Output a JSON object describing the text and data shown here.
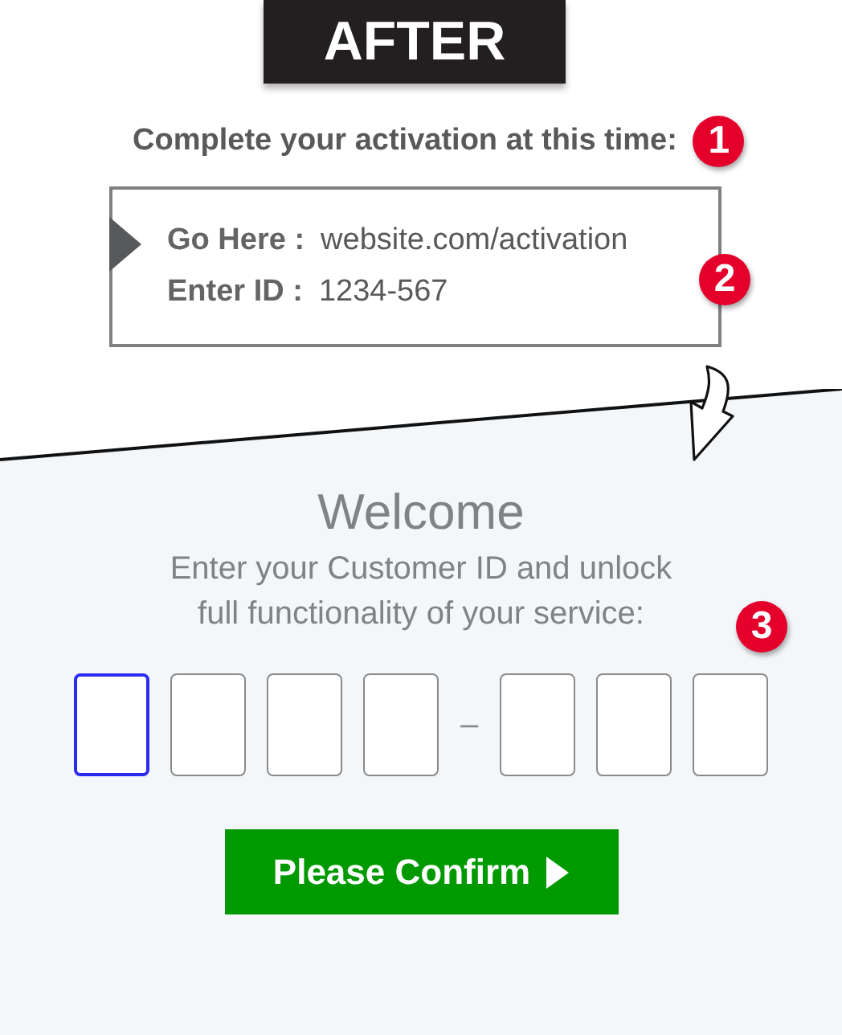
{
  "header": {
    "title": "AFTER"
  },
  "instruction": {
    "text": "Complete your activation at this time:",
    "badge": "1"
  },
  "info_box": {
    "badge": "2",
    "rows": [
      {
        "label": "Go Here :",
        "value": "website.com/activation"
      },
      {
        "label": "Enter ID :",
        "value": "1234-567"
      }
    ]
  },
  "welcome": {
    "title": "Welcome",
    "subtitle_lines": [
      "Enter your Customer ID and unlock",
      "full functionality of your service:"
    ],
    "badge": "3"
  },
  "code_fields": [
    {
      "kind": "box",
      "focused": true
    },
    {
      "kind": "box",
      "focused": false
    },
    {
      "kind": "box",
      "focused": false
    },
    {
      "kind": "box",
      "focused": false
    },
    {
      "kind": "dash",
      "text": "–"
    },
    {
      "kind": "box",
      "focused": false
    },
    {
      "kind": "box",
      "focused": false
    },
    {
      "kind": "box",
      "focused": false
    }
  ],
  "confirm_button": {
    "label": "Please Confirm"
  }
}
